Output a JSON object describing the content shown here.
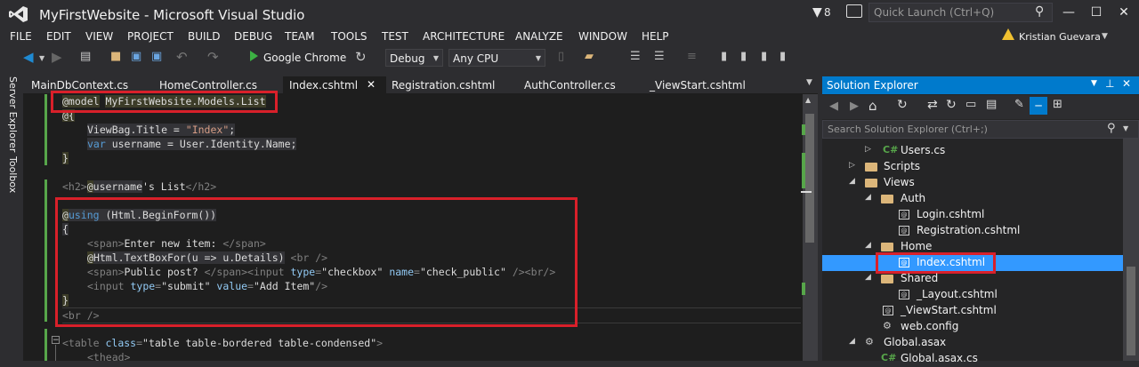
{
  "window": {
    "title": "MyFirstWebsite - Microsoft Visual Studio",
    "notifications_count": "8",
    "quick_launch_placeholder": "Quick Launch (Ctrl+Q)",
    "user_name": "Kristian Guevara"
  },
  "menu": [
    "FILE",
    "EDIT",
    "VIEW",
    "PROJECT",
    "BUILD",
    "DEBUG",
    "TEAM",
    "TOOLS",
    "TEST",
    "ARCHITECTURE",
    "ANALYZE",
    "WINDOW",
    "HELP"
  ],
  "toolbar": {
    "run_target": "Google Chrome",
    "configuration": "Debug",
    "platform": "Any CPU"
  },
  "left_rail": [
    "Server Explorer",
    "Toolbox"
  ],
  "tabs": [
    "MainDbContext.cs",
    "HomeController.cs",
    "Index.cshtml",
    "Registration.cshtml",
    "AuthController.cs",
    "_ViewStart.cshtml"
  ],
  "active_tab": "Index.cshtml",
  "code": {
    "l1_kw": "@model",
    "l1_type": "MyFirstWebsite.Models.List",
    "l2": "@{",
    "l3_a": "ViewBag.Title = ",
    "l3_b": "\"Index\"",
    "l3_c": ";",
    "l4_kw": "var",
    "l4_rest": " username = User.Identity.Name;",
    "l5": "}",
    "l6_open": "<h2>",
    "l6_at": "@",
    "l6_var": "username",
    "l6_text": "'s List",
    "l6_close": "</h2>",
    "l7_at": "@",
    "l7_kw": "using",
    "l7_rest": " (Html.BeginForm())",
    "l8": "{",
    "l9_open": "<span>",
    "l9_text": "Enter new item: ",
    "l9_close": "</span>",
    "l10_at": "@",
    "l10_rest": "Html.TextBoxFor(u => u.Details)",
    "l10_br": "<br />",
    "l11_open": "<span>",
    "l11_text": "Public post? ",
    "l11_close": "</span>",
    "l11_input": "<input ",
    "l11_type_attr": "type",
    "l11_eq1": "=",
    "l11_type_val": "\"checkbox\"",
    "l11_name_attr": " name",
    "l11_eq2": "=",
    "l11_name_val": "\"check_public\"",
    "l11_end": " /><br/>",
    "l12_input": "<input ",
    "l12_type_attr": "type",
    "l12_eq1": "=",
    "l12_type_val": "\"submit\"",
    "l12_value_attr": " value",
    "l12_eq2": "=",
    "l12_value_val": "\"Add Item\"",
    "l12_end": "/>",
    "l13": "}",
    "l14": "<br />",
    "l15_open": "<table ",
    "l15_attr": "class",
    "l15_eq": "=",
    "l15_val": "\"table table-bordered table-condensed\"",
    "l15_end": ">",
    "l16": "<thead>"
  },
  "solution_explorer": {
    "title": "Solution Explorer",
    "search_placeholder": "Search Solution Explorer (Ctrl+;)",
    "items": [
      {
        "label": "Users.cs"
      },
      {
        "label": "Scripts"
      },
      {
        "label": "Views"
      },
      {
        "label": "Auth"
      },
      {
        "label": "Login.cshtml"
      },
      {
        "label": "Registration.cshtml"
      },
      {
        "label": "Home"
      },
      {
        "label": "Index.cshtml"
      },
      {
        "label": "Shared"
      },
      {
        "label": "_Layout.cshtml"
      },
      {
        "label": "_ViewStart.cshtml"
      },
      {
        "label": "web.config"
      },
      {
        "label": "Global.asax"
      },
      {
        "label": "Global.asax.cs"
      }
    ]
  },
  "colors": {
    "accent": "#007acc",
    "highlight_box": "#d9202a",
    "selected_row": "#3399ff"
  }
}
